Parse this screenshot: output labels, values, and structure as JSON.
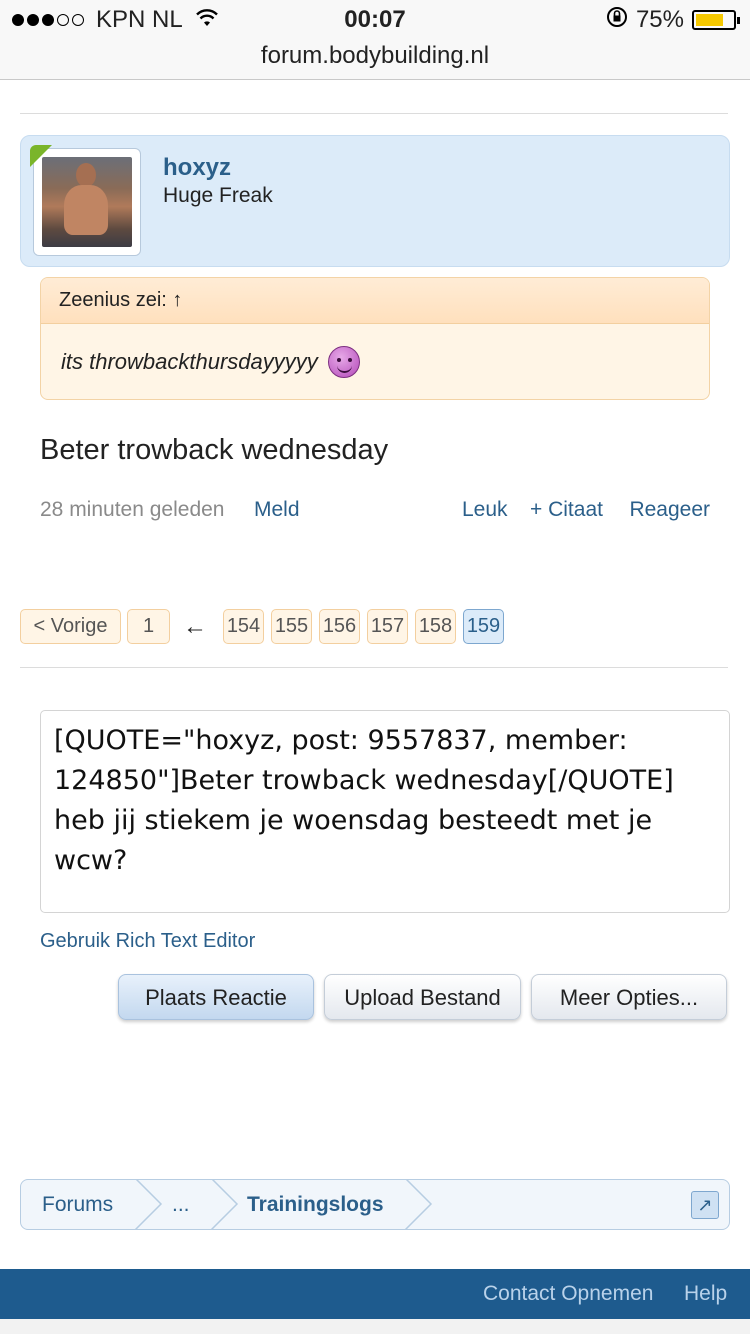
{
  "status_bar": {
    "carrier": "KPN NL",
    "time": "00:07",
    "battery_percent": "75%",
    "battery_level": 0.75,
    "url": "forum.bodybuilding.nl"
  },
  "post": {
    "username": "hoxyz",
    "user_title": "Huge Freak",
    "quote": {
      "header": "Zeenius zei: ↑",
      "text": "its throwbackthursdayyyyy"
    },
    "message": "Beter trowback wednesday",
    "time": "28 minuten geleden",
    "report": "Meld",
    "like": "Leuk",
    "quote_action": "+ Citaat",
    "reply": "Reageer"
  },
  "pagination": {
    "prev": "< Vorige",
    "first": "1",
    "arrow": "←",
    "pages": [
      "154",
      "155",
      "156",
      "157",
      "158",
      "159"
    ],
    "current": "159"
  },
  "reply_box": {
    "value": "[QUOTE=\"hoxyz, post: 9557837, member: 124850\"]Beter trowback wednesday[/QUOTE] heb jij stiekem je woensdag besteedt met je wcw?",
    "rich_text_link": "Gebruik Rich Text Editor",
    "buttons": {
      "post": "Plaats Reactie",
      "upload": "Upload Bestand",
      "more": "Meer Opties..."
    }
  },
  "breadcrumb": {
    "items": [
      "Forums",
      "...",
      "Trainingslogs"
    ]
  },
  "footer": {
    "contact": "Contact Opnemen",
    "help": "Help"
  },
  "colors": {
    "link": "#2b5f8a",
    "footer_bg": "#1e5b8e",
    "user_bg": "#dcebf9",
    "quote_bg": "#fff5e6"
  }
}
